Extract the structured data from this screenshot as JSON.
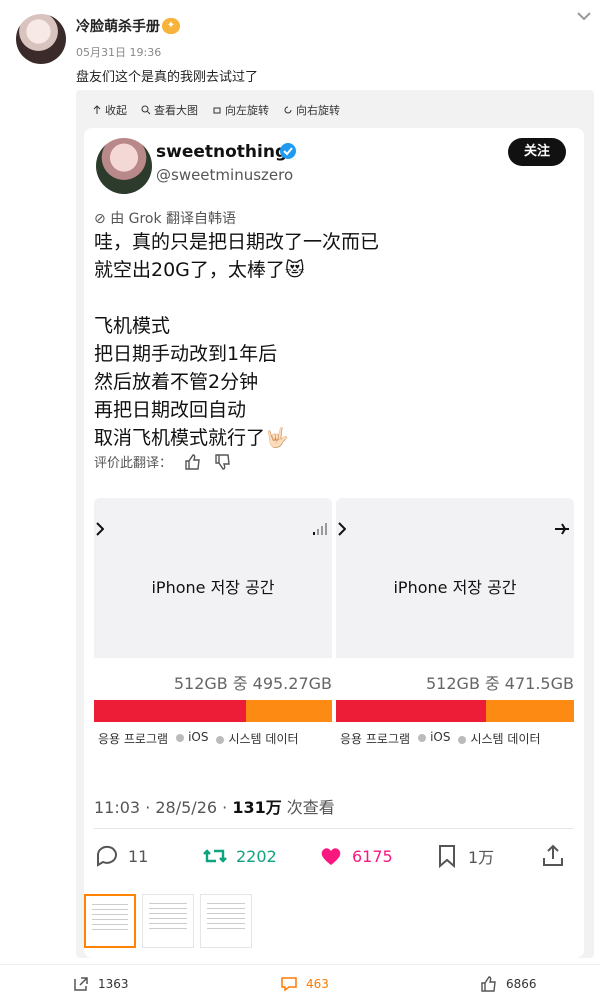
{
  "post": {
    "author": "冷脸萌杀手册",
    "time": "05月31日 19:36",
    "text": "盘友们这个是真的我刚去试过了"
  },
  "toolbar": {
    "collapse": "收起",
    "view_large": "查看大图",
    "rotate_left": "向左旋转",
    "rotate_right": "向右旋转"
  },
  "tweet": {
    "name": "sweetnothing",
    "handle": "@sweetminuszero",
    "follow": "关注",
    "translate_note": "由 Grok 翻译自韩语",
    "lines": [
      "哇，真的只是把日期改了一次而已",
      "就空出20G了，太棒了😻",
      "",
      "飞机模式",
      "把日期手动改到1年后",
      "然后放着不管2分钟",
      "再把日期改回自动",
      "取消飞机模式就行了🤟🏻"
    ],
    "rate_label": "评价此翻译：",
    "meta_time": "11:03 · 28/5/26 · ",
    "views": "131万",
    "views_suffix": " 次查看",
    "replies": "11",
    "retweets": "2202",
    "likes": "6175",
    "bookmarks": "1万"
  },
  "screens": [
    {
      "title": "iPhone 저장 공간",
      "usage": "512GB 중 495.27GB",
      "used_fraction": 0.64,
      "legend": [
        "응용 프로그램",
        "iOS",
        "시스템 데이터"
      ]
    },
    {
      "title": "iPhone 저장 공간",
      "usage": "512GB 중 471.5GB",
      "used_fraction": 0.63,
      "legend": [
        "응용 프로그램",
        "iOS",
        "시스템 데이터"
      ]
    }
  ],
  "footer": {
    "shares": "1363",
    "comments": "463",
    "likes": "6866"
  }
}
